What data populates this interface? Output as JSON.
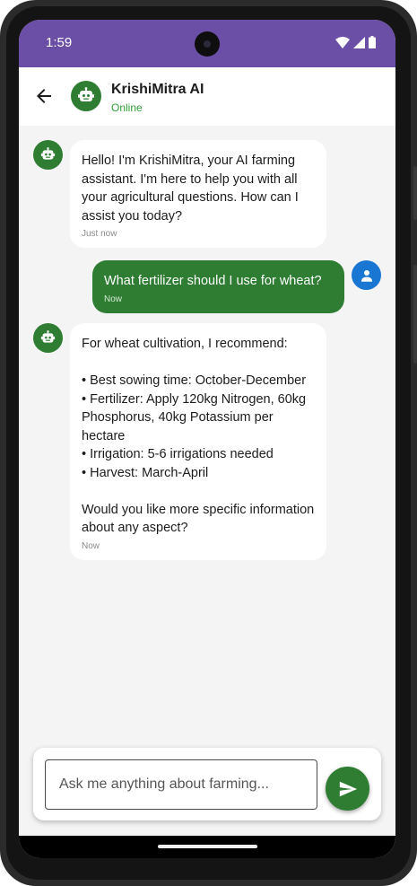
{
  "status_bar": {
    "time": "1:59",
    "icons": [
      "wifi-icon",
      "signal-icon",
      "battery-icon"
    ],
    "background": "#6b4ea6"
  },
  "app_bar": {
    "title": "KrishiMitra AI",
    "status": "Online",
    "back_icon": "arrow-back-icon",
    "avatar_icon": "robot-icon"
  },
  "messages": [
    {
      "sender": "bot",
      "text": "Hello! I'm KrishiMitra, your AI farming assistant. I'm here to help you with all your agricultural questions. How can I assist you today?",
      "time": "Just now"
    },
    {
      "sender": "user",
      "text": "What fertilizer should I use for wheat?",
      "time": "Now"
    },
    {
      "sender": "bot",
      "text": "For wheat cultivation, I recommend:\n\n• Best sowing time: October-December\n• Fertilizer: Apply 120kg Nitrogen, 60kg Phosphorus, 40kg Potassium per hectare\n• Irrigation: 5-6 irrigations needed\n• Harvest: March-April\n\nWould you like more specific information about any aspect?",
      "time": "Now"
    }
  ],
  "composer": {
    "placeholder": "Ask me anything about farming...",
    "value": "",
    "send_icon": "send-icon"
  },
  "colors": {
    "primary_green": "#2e7d32",
    "online_green": "#2e9e3b",
    "user_avatar_blue": "#1976d2",
    "chat_background": "#f4f4f4"
  }
}
